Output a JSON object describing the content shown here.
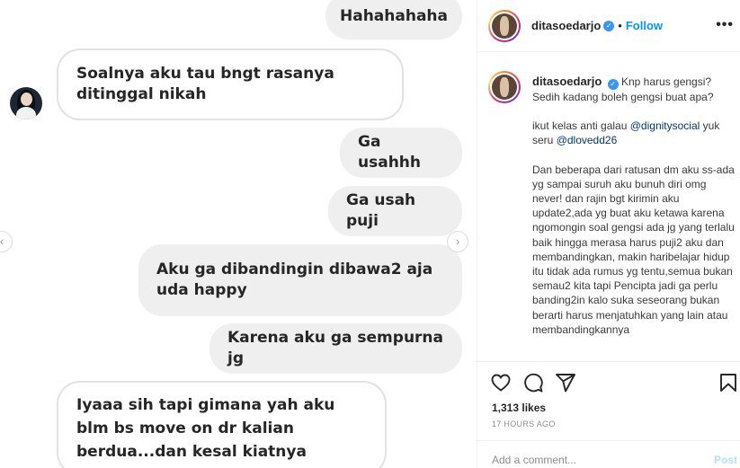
{
  "chat": {
    "messages": [
      {
        "text": "Hahahahaha",
        "side": "out"
      },
      {
        "text": "Soalnya aku tau bngt rasanya ditinggal nikah",
        "side": "in"
      },
      {
        "text": "Ga usahhh",
        "side": "out"
      },
      {
        "text": "Ga usah puji",
        "side": "out"
      },
      {
        "text": "Aku ga dibandingin dibawa2 aja uda happy",
        "side": "out"
      },
      {
        "text": "Karena aku ga sempurna jg",
        "side": "out"
      },
      {
        "text": "Iyaaa sih tapi gimana yah aku blm bs move on dr kalian berdua...dan kesal kiatnya",
        "side": "in"
      }
    ],
    "prev_arrow": "‹",
    "next_arrow": "›"
  },
  "post": {
    "username": "ditasoedarjo",
    "separator": "•",
    "follow_label": "Follow",
    "more_label": "•••",
    "caption": {
      "line1": "Knp harus gengsi? Sedih kadang boleh gengsi buat apa?",
      "line2_prefix": "ikut kelas anti galau",
      "mention1": "@dignitysocial",
      "line2_mid": "yuk seru",
      "mention2": "@dlovedd26",
      "body": "Dan beberapa dari ratusan dm aku ss-ada yg sampai suruh aku bunuh diri omg never! dan rajin bgt kirimin aku update2,ada yg buat aku ketawa karena ngomongin soal gengsi ada jg yang terlalu baik hingga merasa harus puji2 aku dan membandingkan, makin haribelajar hidup itu tidak ada rumus yg tentu,semua bukan semau2 kita tapi Pencipta jadi ga perlu banding2in kalo suka seseorang bukan berarti harus menjatuhkan yang lain atau membandingkannya"
    },
    "likes": "1,313 likes",
    "time": "17 HOURS AGO",
    "comment_placeholder": "Add a comment...",
    "post_label": "Post"
  },
  "icons": {
    "like": "heart-icon",
    "comment": "comment-icon",
    "share": "paper-plane-icon",
    "save": "bookmark-icon"
  }
}
